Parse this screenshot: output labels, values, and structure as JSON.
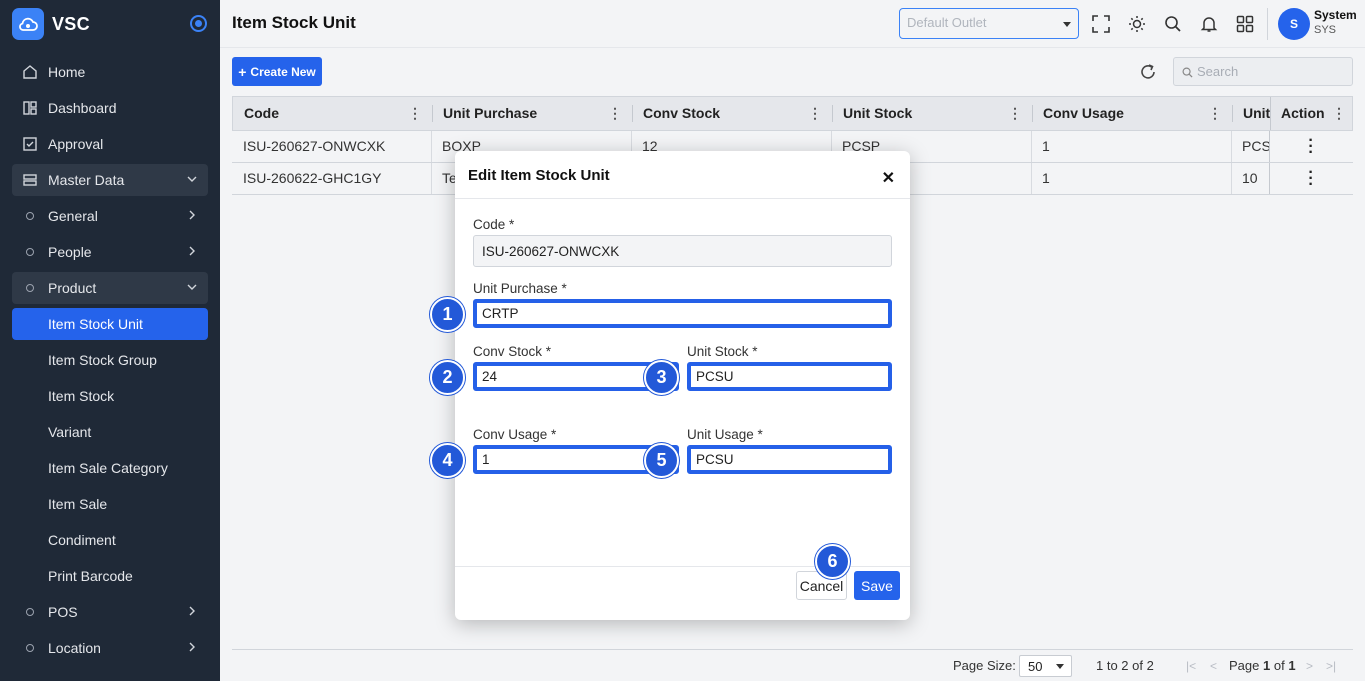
{
  "app": {
    "name": "VSC"
  },
  "sidebar": {
    "items": [
      {
        "label": "Home"
      },
      {
        "label": "Dashboard"
      },
      {
        "label": "Approval"
      },
      {
        "label": "Master Data"
      },
      {
        "label": "General"
      },
      {
        "label": "People"
      },
      {
        "label": "Product"
      },
      {
        "label": "Item Stock Unit"
      },
      {
        "label": "Item Stock Group"
      },
      {
        "label": "Item Stock"
      },
      {
        "label": "Variant"
      },
      {
        "label": "Item Sale Category"
      },
      {
        "label": "Item Sale"
      },
      {
        "label": "Condiment"
      },
      {
        "label": "Print Barcode"
      },
      {
        "label": "POS"
      },
      {
        "label": "Location"
      }
    ]
  },
  "header": {
    "title": "Item Stock Unit",
    "outlet_placeholder": "Default Outlet",
    "user_initial": "S",
    "user_name": "System",
    "user_role": "SYS"
  },
  "toolbar": {
    "create_label": "Create New",
    "search_placeholder": "Search"
  },
  "table": {
    "columns": [
      "Code",
      "Unit Purchase",
      "Conv Stock",
      "Unit Stock",
      "Conv Usage",
      "Unit",
      "Action"
    ],
    "rows": [
      [
        "ISU-260627-ONWCXK",
        "BOXP",
        "12",
        "PCSP",
        "1",
        "PCS"
      ],
      [
        "ISU-260622-GHC1GY",
        "Te",
        "",
        "",
        "1",
        "10"
      ]
    ]
  },
  "pagination": {
    "page_size_label": "Page Size:",
    "page_size": "50",
    "range": "1 to 2 of 2",
    "page_word": "Page",
    "page_current": "1",
    "of_word": "of",
    "page_total": "1"
  },
  "modal": {
    "title": "Edit Item Stock Unit",
    "fields": {
      "code": {
        "label": "Code *",
        "value": "ISU-260627-ONWCXK"
      },
      "unit_purchase": {
        "label": "Unit Purchase *",
        "value": "CRTP"
      },
      "conv_stock": {
        "label": "Conv Stock *",
        "value": "24"
      },
      "unit_stock": {
        "label": "Unit Stock *",
        "value": "PCSU"
      },
      "conv_usage": {
        "label": "Conv Usage *",
        "value": "1"
      },
      "unit_usage": {
        "label": "Unit Usage *",
        "value": "PCSU"
      }
    },
    "cancel_label": "Cancel",
    "save_label": "Save"
  },
  "badges": [
    "1",
    "2",
    "3",
    "4",
    "5",
    "6"
  ],
  "colors": {
    "primary": "#2563eb",
    "sidebar_bg": "#1f2937",
    "highlight": "#2560e8"
  }
}
